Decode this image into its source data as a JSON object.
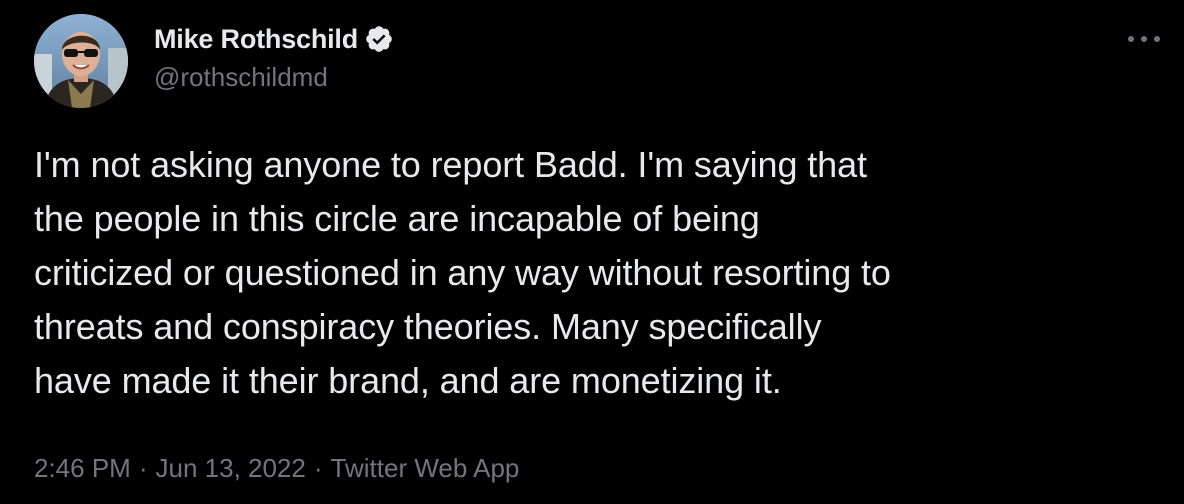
{
  "tweet": {
    "author": {
      "display_name": "Mike Rothschild",
      "handle": "@rothschildmd",
      "verified": true,
      "avatar_icon": "profile-photo"
    },
    "more_icon": "more-options-icon",
    "text": "I'm not asking anyone to report Badd. I'm saying that\nthe people in this circle are incapable of being\ncriticized or questioned in any way without resorting to\nthreats and conspiracy theories. Many specifically\nhave made it their brand, and are monetizing it.",
    "meta": {
      "time": "2:46 PM",
      "separator": "·",
      "date": "Jun 13, 2022",
      "source": "Twitter Web App"
    }
  },
  "colors": {
    "background": "#000000",
    "primary_text": "#e7e9ea",
    "secondary_text": "#71767b",
    "verified_badge": "#e7e9ea"
  }
}
